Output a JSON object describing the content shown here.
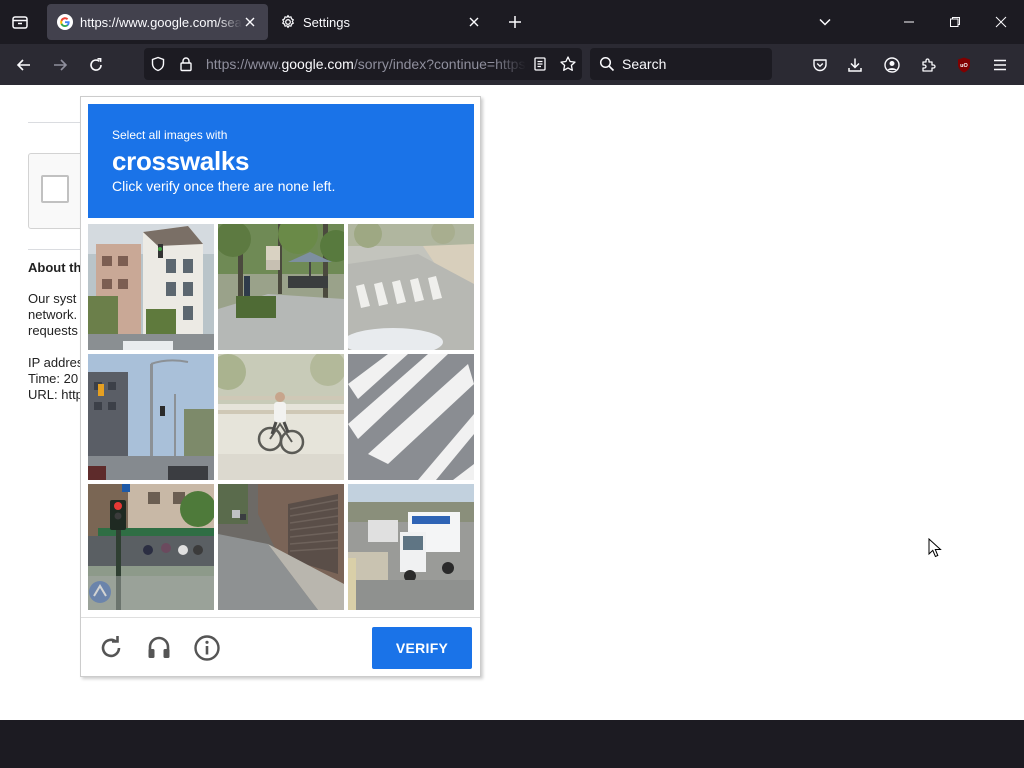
{
  "browser": {
    "tabs": [
      {
        "title": "https://www.google.com/sear",
        "favicon": "google-g-icon",
        "active": true
      },
      {
        "title": "Settings",
        "favicon": "gear-icon",
        "active": false
      }
    ],
    "url": {
      "prefix": "https://www.",
      "host": "google.com",
      "path": "/sorry/index?continue=https://www.google.com/search"
    },
    "search_placeholder": "Search",
    "colors": {
      "chrome_dark": "#1c1b22",
      "toolbar": "#2b2a33",
      "active_tab": "#42414d",
      "ublock_red": "#800000"
    }
  },
  "background_page": {
    "heading": "About th",
    "lines": [
      "Our syst",
      "network.",
      "requests"
    ],
    "ip_label": "IP addres",
    "time_label": "Time: 20",
    "url_label": "URL: http"
  },
  "captcha": {
    "instruction_small": "Select all images with",
    "target": "crosswalks",
    "instruction_detail": "Click verify once there are none left.",
    "tiles": [
      {
        "id": 1,
        "description": "white-building-street"
      },
      {
        "id": 2,
        "description": "park-path-umbrella"
      },
      {
        "id": 3,
        "description": "road-crosswalk-stripes"
      },
      {
        "id": 4,
        "description": "city-intersection-streetlights"
      },
      {
        "id": 5,
        "description": "cyclist-on-path"
      },
      {
        "id": 6,
        "description": "crosswalk-closeup"
      },
      {
        "id": 7,
        "description": "traffic-light-pedestrians"
      },
      {
        "id": 8,
        "description": "sidewalk-shutters"
      },
      {
        "id": 9,
        "description": "white-truck-road"
      }
    ],
    "verify_label": "VERIFY",
    "accent": "#1a73e8"
  }
}
